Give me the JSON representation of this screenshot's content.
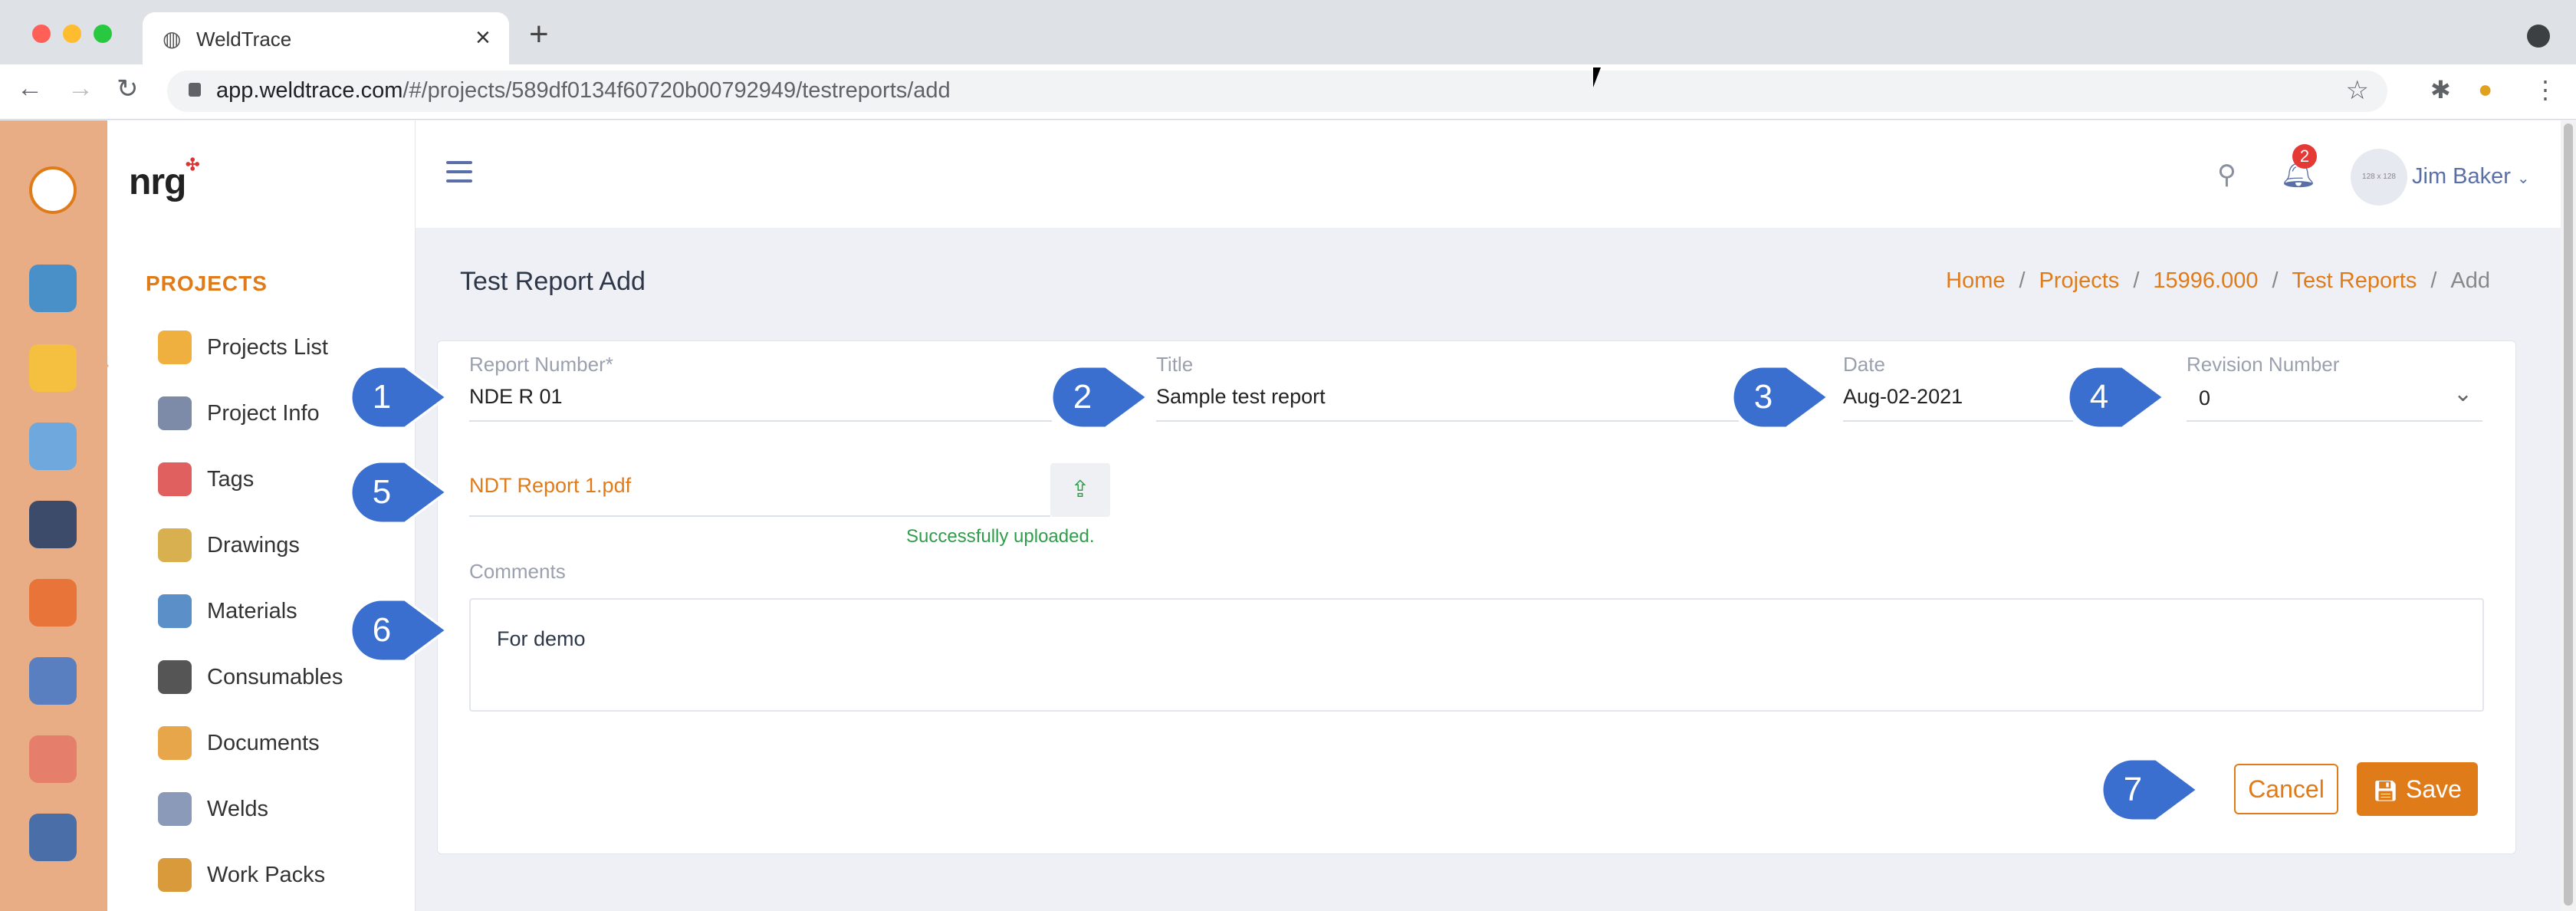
{
  "browser": {
    "tab_title": "WeldTrace",
    "url_host": "app.weldtrace.com",
    "url_path": "/#/projects/589df0134f60720b00792949/testreports/add"
  },
  "sidebar": {
    "logo_text": "nrg",
    "section_title": "PROJECTS",
    "items": [
      {
        "label": "Projects List",
        "icon": "camera-icon"
      },
      {
        "label": "Project Info",
        "icon": "gears-icon"
      },
      {
        "label": "Tags",
        "icon": "tag-icon"
      },
      {
        "label": "Drawings",
        "icon": "drawing-tools-icon"
      },
      {
        "label": "Materials",
        "icon": "materials-stack-icon"
      },
      {
        "label": "Consumables",
        "icon": "spool-icon"
      },
      {
        "label": "Documents",
        "icon": "folder-icon"
      },
      {
        "label": "Welds",
        "icon": "welding-icon"
      },
      {
        "label": "Work Packs",
        "icon": "package-icon"
      }
    ]
  },
  "header": {
    "notification_count": "2",
    "avatar_placeholder": "128 x 128",
    "user_name": "Jim Baker"
  },
  "page": {
    "title": "Test Report Add",
    "breadcrumb": [
      "Home",
      "Projects",
      "15996.000",
      "Test Reports",
      "Add"
    ]
  },
  "form": {
    "report_number": {
      "label": "Report Number*",
      "value": "NDE R 01"
    },
    "title": {
      "label": "Title",
      "value": "Sample test report"
    },
    "date": {
      "label": "Date",
      "value": "Aug-02-2021"
    },
    "revision": {
      "label": "Revision Number",
      "value": "0"
    },
    "file": {
      "name": "NDT Report 1.pdf",
      "status": "Successfully uploaded."
    },
    "comments": {
      "label": "Comments",
      "value": "For demo"
    },
    "cancel_label": "Cancel",
    "save_label": "Save"
  },
  "callouts": [
    "1",
    "2",
    "3",
    "4",
    "5",
    "6",
    "7"
  ],
  "colors": {
    "accent": "#e07b1a",
    "rail": "#e8ad84",
    "callout": "#3a6fd0",
    "success": "#2e9e4a"
  }
}
